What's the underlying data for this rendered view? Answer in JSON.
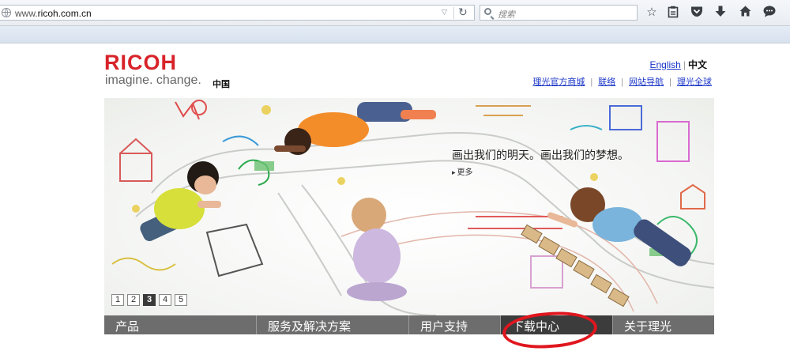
{
  "browser": {
    "url_prefix": "www.",
    "url_domain": "ricoh.com.cn",
    "search_placeholder": "搜索"
  },
  "header": {
    "logo_text": "RICOH",
    "tagline": "imagine. change.",
    "region": "中国",
    "languages": [
      "English",
      "中文"
    ],
    "links": [
      "理光官方商城",
      "联络",
      "网站导航",
      "理光全球"
    ]
  },
  "hero": {
    "title": "画出我们的明天。画出我们的梦想。",
    "more": "更多",
    "pages": [
      "1",
      "2",
      "3",
      "4",
      "5"
    ],
    "active_page": "3"
  },
  "nav": {
    "items": [
      "产品",
      "服务及解决方案",
      "用户支持",
      "下载中心",
      "关于理光"
    ]
  },
  "colors": {
    "brand_red": "#d8232a",
    "link_blue": "#1a35c8",
    "nav_gray": "#6d6d6d",
    "annotation_red": "#e0161e"
  }
}
